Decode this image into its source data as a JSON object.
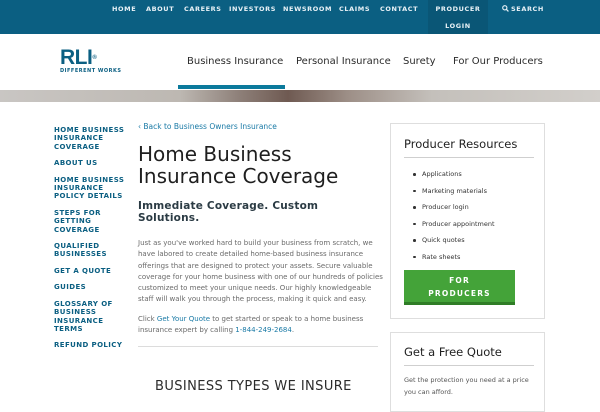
{
  "topnav": {
    "items": [
      "HOME",
      "ABOUT",
      "CAREERS",
      "INVESTORS",
      "NEWSROOM",
      "CLAIMS",
      "CONTACT"
    ],
    "producer_login_line1": "PRODUCER",
    "producer_login_line2": "LOGIN",
    "search_label": "SEARCH"
  },
  "logo": {
    "mark": "RLI",
    "trademark": "®",
    "tagline": "DIFFERENT WORKS"
  },
  "mainnav": {
    "items": [
      "Business Insurance",
      "Personal Insurance",
      "Surety",
      "For Our Producers"
    ],
    "active": "Business Insurance"
  },
  "sidenav": {
    "items": [
      "HOME BUSINESS INSURANCE COVERAGE",
      "ABOUT US",
      "HOME BUSINESS INSURANCE POLICY DETAILS",
      "STEPS FOR GETTING COVERAGE",
      "QUALIFIED BUSINESSES",
      "GET A QUOTE",
      "GUIDES",
      "GLOSSARY OF BUSINESS INSURANCE TERMS",
      "REFUND POLICY"
    ]
  },
  "main": {
    "back_link": "‹ Back to Business Owners Insurance",
    "title": "Home Business Insurance Coverage",
    "subheading": "Immediate Coverage. Custom Solutions.",
    "body": "Just as you've worked hard to build your business from scratch, we have labored to create detailed home-based business insurance offerings that are designed to protect your assets. Secure valuable coverage for your home business with one of our hundreds of policies customized to meet your unique needs. Our highly knowledgeable staff will walk you through the process, making it quick and easy.",
    "cta_prefix": "Click ",
    "cta_link": "Get Your Quote",
    "cta_middle": " to get started or speak to a home business insurance expert by calling ",
    "cta_phone": "1-844-249-2684",
    "cta_suffix": ".",
    "section_title": "BUSINESS TYPES WE INSURE"
  },
  "producer_card": {
    "title": "Producer Resources",
    "items": [
      "Applications",
      "Marketing materials",
      "Producer login",
      "Producer appointment",
      "Quick quotes",
      "Rate sheets"
    ],
    "button_line1": "FOR",
    "button_line2": "PRODUCERS"
  },
  "quote_card": {
    "title": "Get a Free Quote",
    "text": "Get the protection you need at a price you can afford."
  },
  "colors": {
    "brand_blue": "#0b5f82",
    "link_blue": "#1a7aa6",
    "button_green": "#44a339"
  }
}
